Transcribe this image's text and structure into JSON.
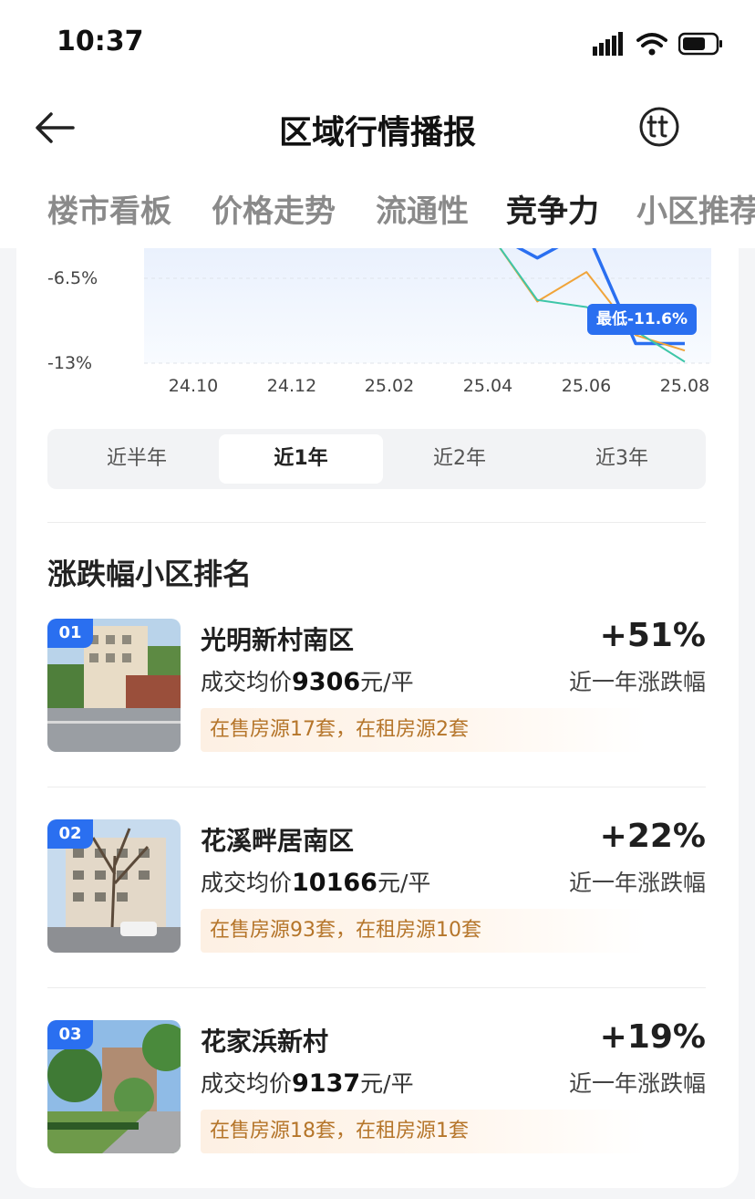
{
  "status_bar": {
    "time": "10:37"
  },
  "navbar": {
    "title": "区域行情播报"
  },
  "tabs": [
    {
      "label": "楼市看板",
      "active": false
    },
    {
      "label": "价格走势",
      "active": false
    },
    {
      "label": "流通性",
      "active": false
    },
    {
      "label": "竞争力",
      "active": true
    },
    {
      "label": "小区推荐",
      "active": false
    }
  ],
  "chart_data": {
    "type": "line",
    "x": [
      "24.10",
      "24.12",
      "25.02",
      "25.04",
      "25.06",
      "25.08"
    ],
    "y_ticks": [
      "-6.5%",
      "-13%"
    ],
    "ylim_visible": [
      -13,
      -3.5
    ],
    "series": [
      {
        "color": "#2a6ff0",
        "x": [
          "25.03",
          "25.04",
          "25.05",
          "25.06",
          "25.07",
          "25.08"
        ],
        "values": [
          -4.0,
          -3.6,
          -5.5,
          -3.6,
          -11.6,
          -11.6
        ]
      },
      {
        "color": "#f0a43a",
        "x": [
          "25.04",
          "25.05",
          "25.06",
          "25.07",
          "25.08"
        ],
        "values": [
          -3.6,
          -8.6,
          -6.5,
          -11.0,
          -12.1
        ]
      },
      {
        "color": "#3dc6a8",
        "x": [
          "25.04",
          "25.05",
          "25.06",
          "25.07",
          "25.08"
        ],
        "values": [
          -3.6,
          -8.5,
          -9.0,
          -10.7,
          -12.9
        ]
      }
    ],
    "annotation": "最低-11.6%"
  },
  "period_selector": {
    "options": [
      "近半年",
      "近1年",
      "近2年",
      "近3年"
    ],
    "selected": "近1年"
  },
  "ranking": {
    "title": "涨跌幅小区排名",
    "items": [
      {
        "rank": "01",
        "name": "光明新村南区",
        "price_prefix": "成交均价",
        "price": "9306",
        "price_unit": "元/平",
        "change": "+51%",
        "change_label": "近一年涨跌幅",
        "supply": "在售房源17套，在租房源2套"
      },
      {
        "rank": "02",
        "name": "花溪畔居南区",
        "price_prefix": "成交均价",
        "price": "10166",
        "price_unit": "元/平",
        "change": "+22%",
        "change_label": "近一年涨跌幅",
        "supply": "在售房源93套，在租房源10套"
      },
      {
        "rank": "03",
        "name": "花家浜新村",
        "price_prefix": "成交均价",
        "price": "9137",
        "price_unit": "元/平",
        "change": "+19%",
        "change_label": "近一年涨跌幅",
        "supply": "在售房源18套，在租房源1套"
      }
    ]
  }
}
